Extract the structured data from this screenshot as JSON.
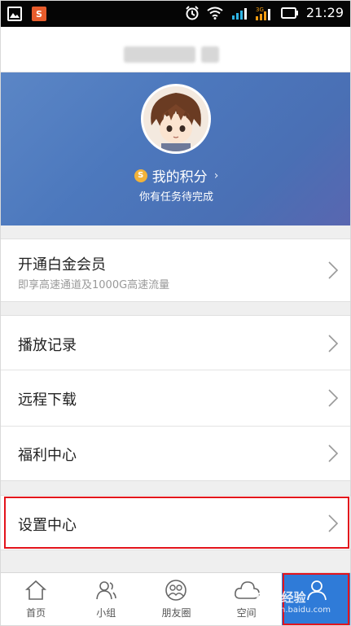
{
  "status_bar": {
    "time": "21:29",
    "network_label": "3G",
    "icons": [
      "gallery-icon",
      "app-s-icon",
      "alarm-icon",
      "wifi-icon",
      "signal-icon",
      "battery-icon"
    ]
  },
  "profile": {
    "points_label": "我的积分",
    "points_arrow": "›",
    "coin_symbol": "S",
    "task_text": "你有任务待完成"
  },
  "vip": {
    "title": "开通白金会员",
    "subtitle": "即享高速通道及1000G高速流量"
  },
  "menu": {
    "items": [
      {
        "label": "播放记录"
      },
      {
        "label": "远程下载"
      },
      {
        "label": "福利中心"
      }
    ]
  },
  "settings": {
    "label": "设置中心"
  },
  "tabs": [
    {
      "label": "首页",
      "icon": "home-icon"
    },
    {
      "label": "小组",
      "icon": "group-icon"
    },
    {
      "label": "朋友圈",
      "icon": "friends-icon"
    },
    {
      "label": "空间",
      "icon": "cloud-icon"
    },
    {
      "label": "",
      "icon": "person-icon",
      "active": true
    }
  ],
  "watermark": {
    "text": "Bai 经验",
    "url": "jingyan.baidu.com"
  },
  "colors": {
    "header_gradient_start": "#5b86c6",
    "header_gradient_end": "#5966b0",
    "active_tab": "#2f7bd8",
    "highlight_border": "#e3141c",
    "coin": "#f2b33a"
  }
}
